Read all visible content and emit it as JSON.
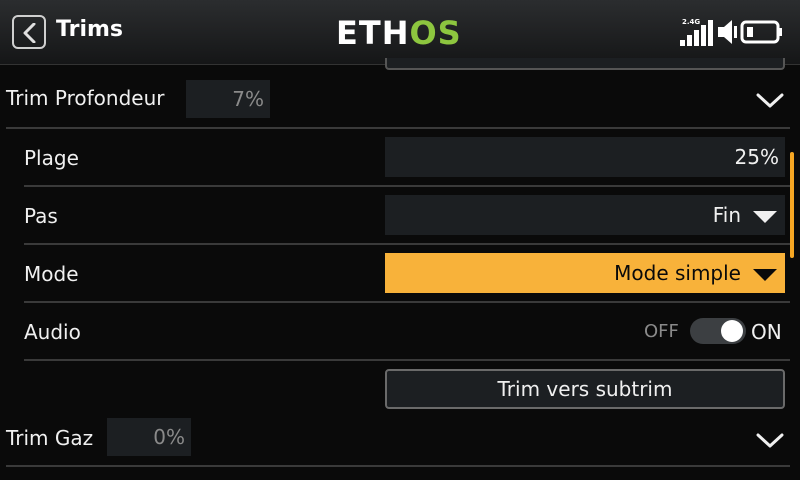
{
  "header": {
    "title": "Trims",
    "logo_white": "ETH",
    "logo_green": "OS",
    "radio_band": "2.4G",
    "icons": [
      "back-arrow-icon",
      "signal-bars-icon",
      "speaker-icon",
      "battery-icon"
    ]
  },
  "trims": [
    {
      "label": "Trim Profondeur",
      "value": "7%",
      "expanded": true,
      "settings": {
        "range_label": "Plage",
        "range_value": "25%",
        "step_label": "Pas",
        "step_value": "Fin",
        "mode_label": "Mode",
        "mode_value": "Mode simple",
        "audio_label": "Audio",
        "audio_off": "OFF",
        "audio_on": "ON",
        "audio_enabled": true,
        "subtrim_button": "Trim vers subtrim"
      }
    },
    {
      "label": "Trim Gaz",
      "value": "0%",
      "expanded": false
    }
  ],
  "colors": {
    "accent": "#f5a623",
    "selected_field": "#f8b23a",
    "logo_green": "#8dc63f",
    "background": "#0a0a0a",
    "field_bg": "#1c1f22"
  }
}
